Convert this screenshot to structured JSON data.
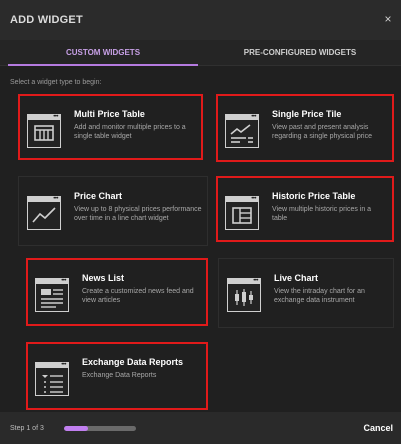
{
  "dialog": {
    "title": "ADD WIDGET",
    "close_glyph": "×"
  },
  "tabs": [
    {
      "label": "CUSTOM WIDGETS",
      "active": true
    },
    {
      "label": "PRE-CONFIGURED WIDGETS",
      "active": false
    }
  ],
  "prompt": "Select a widget type to begin:",
  "widgets": [
    {
      "name": "Multi Price Table",
      "desc": "Add and monitor multiple prices to a single table widget",
      "icon": "table-icon",
      "highlighted": true
    },
    {
      "name": "Single Price Tile",
      "desc": "View past and present analysis regarding a single physical price",
      "icon": "price-tile-icon",
      "highlighted": true
    },
    {
      "name": "Price Chart",
      "desc": "View up to 8 physical prices performance over time in a line chart widget",
      "icon": "line-chart-icon",
      "highlighted": false
    },
    {
      "name": "Historic Price Table",
      "desc": "View multiple historic prices in a table",
      "icon": "historic-table-icon",
      "highlighted": true
    },
    {
      "name": "News List",
      "desc": "Create a customized news feed and view articles",
      "icon": "news-list-icon",
      "highlighted": true
    },
    {
      "name": "Live Chart",
      "desc": "View the intraday chart for an exchange data instrument",
      "icon": "candlestick-icon",
      "highlighted": false
    },
    {
      "name": "Exchange Data Reports",
      "desc": "Exchange Data Reports",
      "icon": "report-list-icon",
      "highlighted": true
    }
  ],
  "footer": {
    "step_label": "Step 1 of 3",
    "progress": 0.33,
    "cancel_label": "Cancel"
  },
  "colors": {
    "accent": "#b57be0",
    "highlight_border": "#e01a1a",
    "background": "#202020"
  }
}
